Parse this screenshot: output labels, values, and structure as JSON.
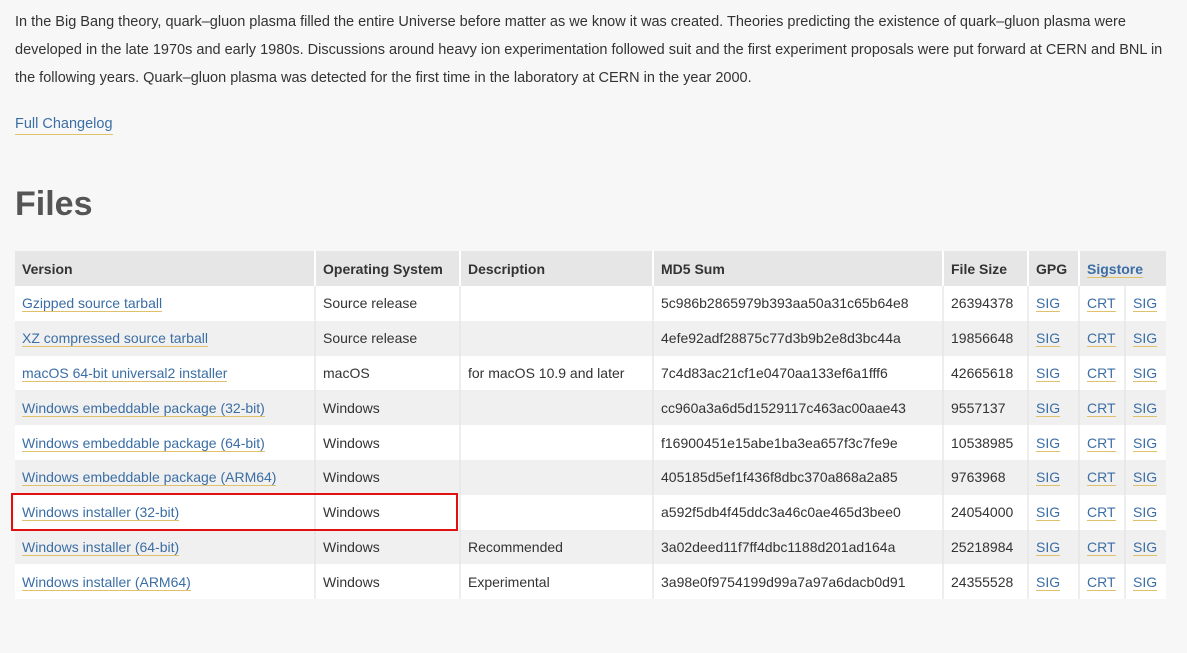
{
  "intro": {
    "text": "In the Big Bang theory, quark–gluon plasma filled the entire Universe before matter as we know it was created. Theories predicting the existence of quark–gluon plasma were developed in the late 1970s and early 1980s. Discussions around heavy ion experimentation followed suit and the first experiment proposals were put forward at CERN and BNL in the following years. Quark–gluon plasma was detected for the first time in the laboratory at CERN in the year 2000."
  },
  "changelog_link": "Full Changelog",
  "files_heading": "Files",
  "table": {
    "headers": {
      "version": "Version",
      "os": "Operating System",
      "description": "Description",
      "md5": "MD5 Sum",
      "size": "File Size",
      "gpg": "GPG",
      "sigstore": "Sigstore"
    },
    "rows": [
      {
        "version": "Gzipped source tarball",
        "os": "Source release",
        "description": "",
        "md5": "5c986b2865979b393aa50a31c65b64e8",
        "size": "26394378",
        "gpg": "SIG",
        "crt": "CRT",
        "sig": "SIG"
      },
      {
        "version": "XZ compressed source tarball",
        "os": "Source release",
        "description": "",
        "md5": "4efe92adf28875c77d3b9b2e8d3bc44a",
        "size": "19856648",
        "gpg": "SIG",
        "crt": "CRT",
        "sig": "SIG"
      },
      {
        "version": "macOS 64-bit universal2 installer",
        "os": "macOS",
        "description": "for macOS 10.9 and later",
        "md5": "7c4d83ac21cf1e0470aa133ef6a1fff6",
        "size": "42665618",
        "gpg": "SIG",
        "crt": "CRT",
        "sig": "SIG"
      },
      {
        "version": "Windows embeddable package (32-bit)",
        "os": "Windows",
        "description": "",
        "md5": "cc960a3a6d5d1529117c463ac00aae43",
        "size": "9557137",
        "gpg": "SIG",
        "crt": "CRT",
        "sig": "SIG"
      },
      {
        "version": "Windows embeddable package (64-bit)",
        "os": "Windows",
        "description": "",
        "md5": "f16900451e15abe1ba3ea657f3c7fe9e",
        "size": "10538985",
        "gpg": "SIG",
        "crt": "CRT",
        "sig": "SIG"
      },
      {
        "version": "Windows embeddable package (ARM64)",
        "os": "Windows",
        "description": "",
        "md5": "405185d5ef1f436f8dbc370a868a2a85",
        "size": "9763968",
        "gpg": "SIG",
        "crt": "CRT",
        "sig": "SIG"
      },
      {
        "version": "Windows installer (32-bit)",
        "os": "Windows",
        "description": "",
        "md5": "a592f5db4f45ddc3a46c0ae465d3bee0",
        "size": "24054000",
        "gpg": "SIG",
        "crt": "CRT",
        "sig": "SIG"
      },
      {
        "version": "Windows installer (64-bit)",
        "os": "Windows",
        "description": "Recommended",
        "md5": "3a02deed11f7ff4dbc1188d201ad164a",
        "size": "25218984",
        "gpg": "SIG",
        "crt": "CRT",
        "sig": "SIG"
      },
      {
        "version": "Windows installer (ARM64)",
        "os": "Windows",
        "description": "Experimental",
        "md5": "3a98e0f9754199d99a7a97a6dacb0d91",
        "size": "24355528",
        "gpg": "SIG",
        "crt": "CRT",
        "sig": "SIG"
      }
    ]
  },
  "colors": {
    "link": "#3b6ea5",
    "link_underline": "#e0c16b",
    "highlight": "#e01010"
  }
}
